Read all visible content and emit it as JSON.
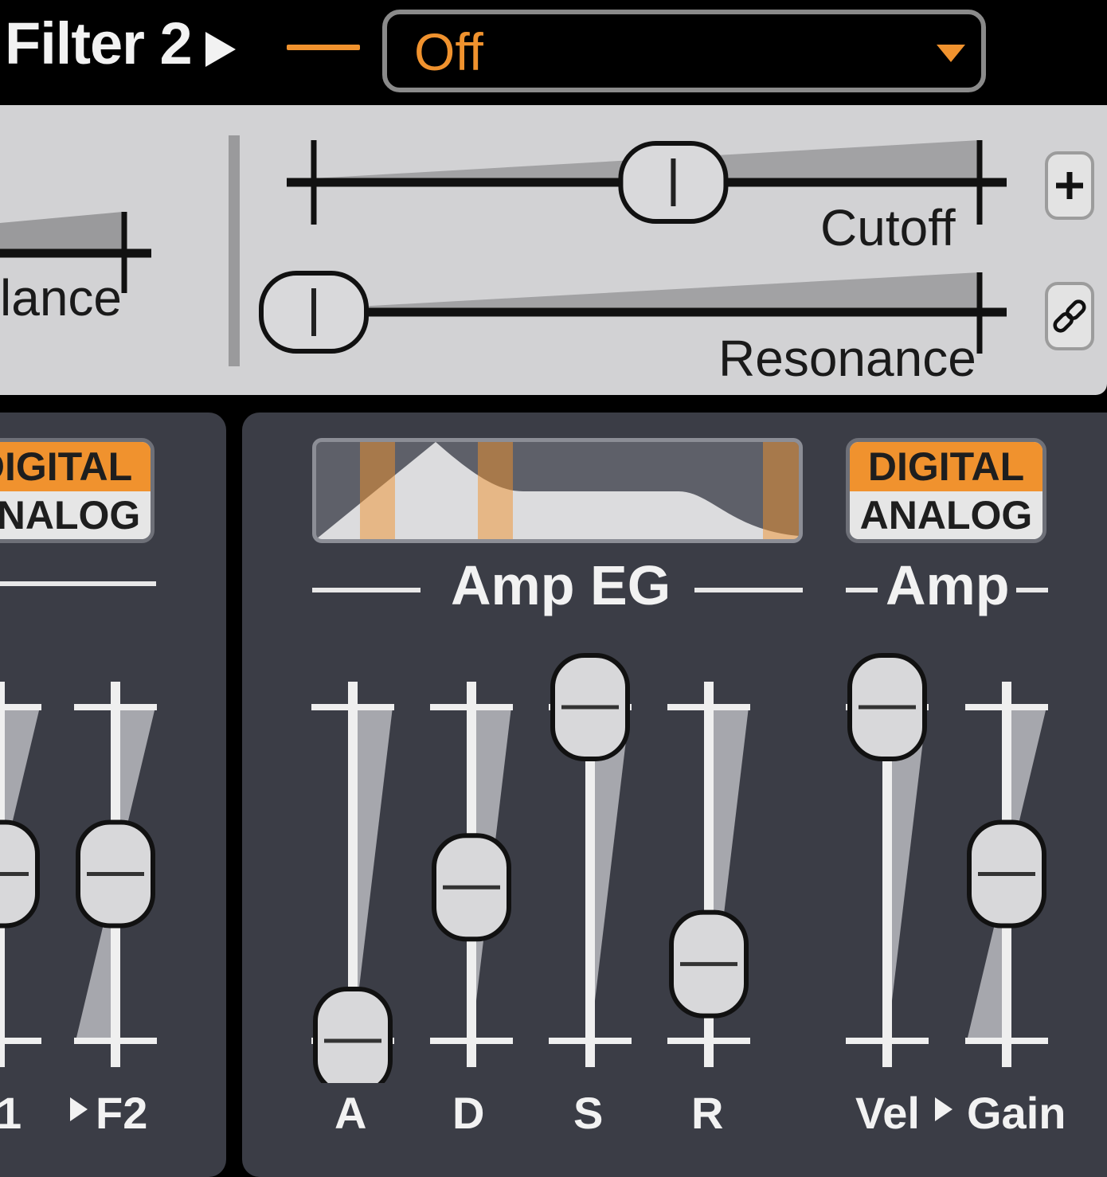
{
  "header": {
    "title": "Filter 2",
    "filter_type": {
      "value": "Off"
    },
    "accent_color": "#f0922e"
  },
  "filter_panel": {
    "balance_label": "lance",
    "cutoff": {
      "label": "Cutoff",
      "value": 0.54
    },
    "resonance": {
      "label": "Resonance",
      "value": 0.0
    },
    "buttons": {
      "add_icon": "plus-icon",
      "link_icon": "link-icon"
    }
  },
  "left_panel": {
    "mode_switch": {
      "top": "DIGITAL",
      "bottom": "ANALOG",
      "selected": "DIGITAL"
    },
    "sliders": [
      {
        "label": "1",
        "value": 0.5
      },
      {
        "label": "F2",
        "value": 0.5
      }
    ]
  },
  "amp_eg": {
    "title": "Amp EG",
    "sliders": [
      {
        "label": "A",
        "value": 0.0
      },
      {
        "label": "D",
        "value": 0.46
      },
      {
        "label": "S",
        "value": 1.0
      },
      {
        "label": "R",
        "value": 0.23
      }
    ]
  },
  "amp": {
    "title": "Amp",
    "mode_switch": {
      "top": "DIGITAL",
      "bottom": "ANALOG",
      "selected": "DIGITAL"
    },
    "sliders": [
      {
        "label": "Vel",
        "value": 1.0
      },
      {
        "label": "Gain",
        "value": 0.5
      }
    ]
  }
}
